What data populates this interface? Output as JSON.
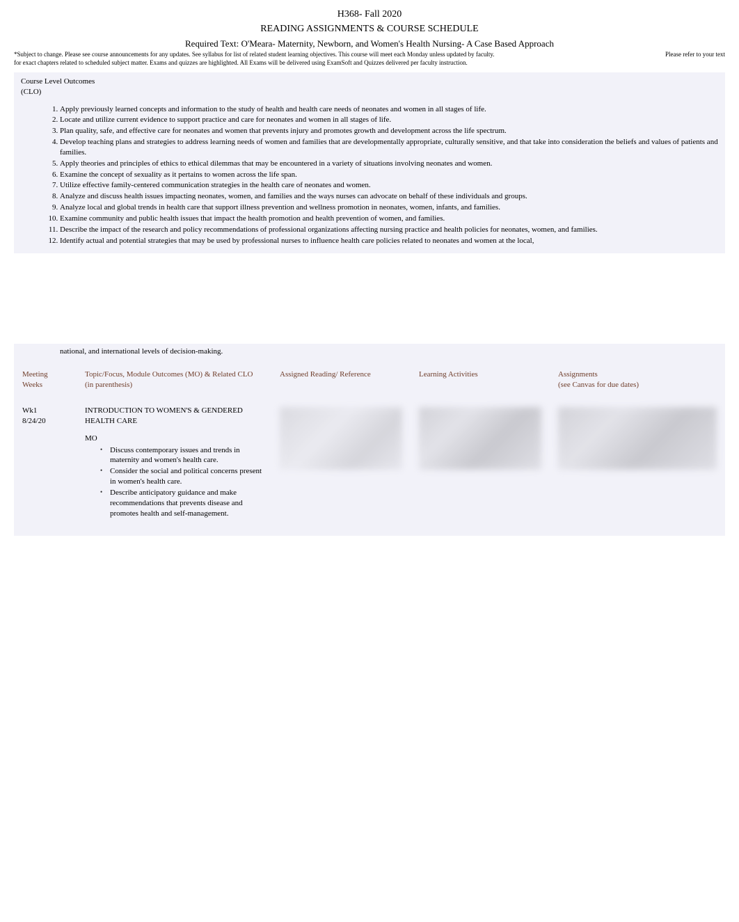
{
  "header": {
    "title": "H368- Fall 2020",
    "subtitle": "READING ASSIGNMENTS & COURSE SCHEDULE",
    "required_text": "Required Text: O'Meara- Maternity, Newborn, and Women's Health Nursing- A Case Based Approach",
    "fineprint_main": "*Subject to change. Please see course announcements for any updates. See syllabus for list of related student learning objectives. This course will meet each Monday unless updated by faculty.",
    "fineprint_refer": "Please refer to your text",
    "fineprint_line2": "for exact chapters related to scheduled subject matter. Exams and quizzes are highlighted. All Exams will be delivered using ExamSoft and Quizzes delivered per faculty instruction."
  },
  "clo": {
    "heading": "Course Level Outcomes",
    "paren": "(CLO)",
    "items": [
      "Apply previously learned concepts and information to the study of health and health care needs of neonates and women in all stages of life.",
      "Locate and utilize current evidence to support practice and care for neonates and women in all stages of life.",
      "Plan quality, safe, and effective care for neonates and women that prevents injury and promotes growth and development across the life spectrum.",
      "Develop teaching plans and strategies to address learning needs of women and families that are developmentally appropriate, culturally sensitive, and that take into consideration the beliefs and values of patients and families.",
      "Apply theories and principles of ethics to ethical dilemmas that may be encountered in a variety of situations involving neonates and women.",
      "Examine the concept of sexuality as it pertains to women across the life span.",
      "Utilize effective family-centered communication strategies in the health care of neonates and women.",
      "Analyze and discuss health issues impacting neonates, women, and families and the ways nurses can advocate on behalf of these individuals and groups.",
      "Analyze local and global trends in health care that support illness prevention and wellness promotion in neonates, women, infants, and families.",
      "Examine community and public health issues that impact the health promotion and health prevention of women, and families.",
      "Describe the impact of the research and policy recommendations of professional organizations affecting nursing practice and health policies for neonates, women, and families.",
      "Identify actual and potential strategies that may be used by professional nurses to influence health care policies related to neonates and women at the local,"
    ],
    "continuation": "national, and international levels of decision-making."
  },
  "schedule": {
    "headers": {
      "meeting": "Meeting Weeks",
      "topic": "Topic/Focus, Module Outcomes (MO) & Related CLO",
      "topic_paren": "(in parenthesis)",
      "reading": "Assigned Reading/ Reference",
      "learning": "Learning Activities",
      "assignments": "Assignments",
      "assignments_sub": "(see Canvas for due dates)"
    },
    "rows": [
      {
        "week": "Wk1",
        "date": "8/24/20",
        "topic_title": "INTRODUCTION TO WOMEN'S & GENDERED HEALTH CARE",
        "mo_label": "MO",
        "mo_items": [
          "Discuss contemporary issues and trends in maternity and women's health care.",
          "Consider the social and political concerns present in women's health care.",
          "Describe anticipatory guidance and make recommendations that prevents disease and promotes health and self-management."
        ]
      }
    ]
  }
}
